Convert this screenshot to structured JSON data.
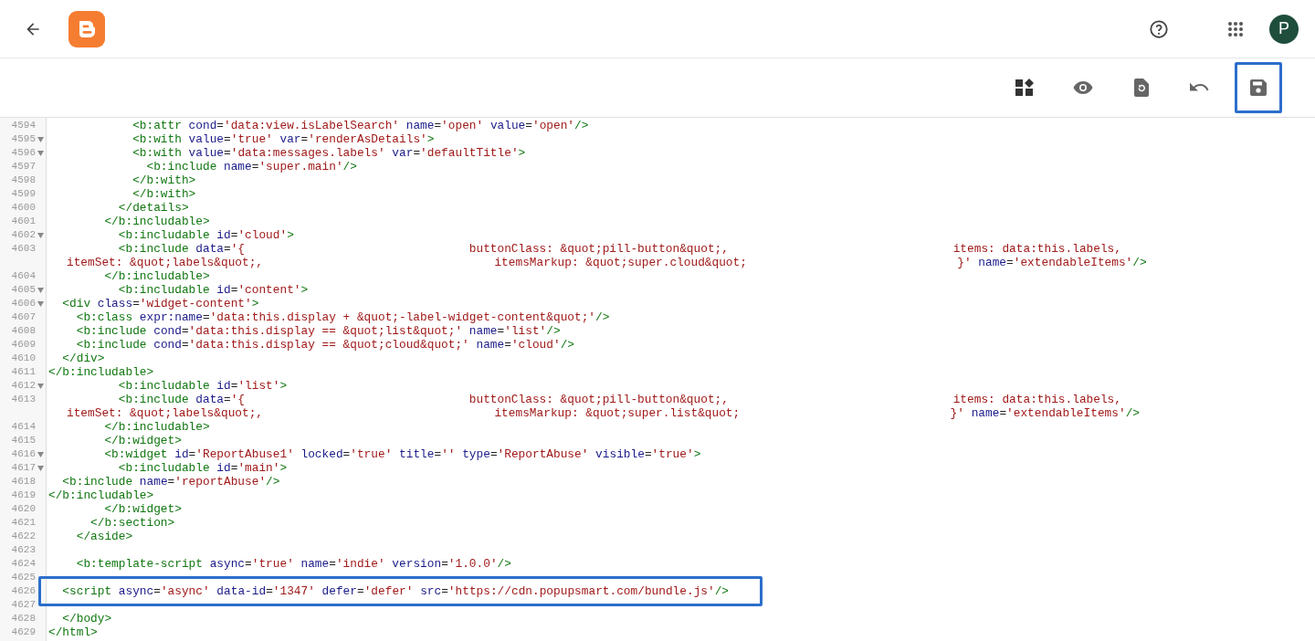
{
  "header": {
    "avatar": {
      "initial": "P"
    }
  },
  "toolbar": [
    {
      "kind": "layout",
      "highlighted": false
    },
    {
      "kind": "preview",
      "highlighted": false
    },
    {
      "kind": "revert",
      "highlighted": false
    },
    {
      "kind": "undo",
      "highlighted": false
    },
    {
      "kind": "save",
      "highlighted": true
    }
  ],
  "editor": {
    "lines": [
      {
        "number": "4594",
        "foldable": false,
        "highlighted": false,
        "text": "            <b:attr cond='data:view.isLabelSearch' name='open' value='open'/>"
      },
      {
        "number": "4595",
        "foldable": true,
        "highlighted": false,
        "text": "            <b:with value='true' var='renderAsDetails'>"
      },
      {
        "number": "4596",
        "foldable": true,
        "highlighted": false,
        "text": "            <b:with value='data:messages.labels' var='defaultTitle'>"
      },
      {
        "number": "4597",
        "foldable": false,
        "highlighted": false,
        "text": "              <b:include name='super.main'/>"
      },
      {
        "number": "4598",
        "foldable": false,
        "highlighted": false,
        "text": "            </b:with>"
      },
      {
        "number": "4599",
        "foldable": false,
        "highlighted": false,
        "text": "            </b:with>"
      },
      {
        "number": "4600",
        "foldable": false,
        "highlighted": false,
        "text": "          </details>"
      },
      {
        "number": "4601",
        "foldable": false,
        "highlighted": false,
        "text": "        </b:includable>"
      },
      {
        "number": "4602",
        "foldable": true,
        "highlighted": false,
        "text": "          <b:includable id='cloud'>"
      },
      {
        "number": "4603",
        "foldable": false,
        "highlighted": false,
        "text": "          <b:include data='{                                buttonClass: &quot;pill-button&quot;,                                items: data:this.labels,",
        "wrap": "itemSet: &quot;labels&quot;,                                 itemsMarkup: &quot;super.cloud&quot;                              }' name='extendableItems'/>"
      },
      {
        "number": "4604",
        "foldable": false,
        "highlighted": false,
        "text": "        </b:includable>"
      },
      {
        "number": "4605",
        "foldable": true,
        "highlighted": false,
        "text": "          <b:includable id='content'>"
      },
      {
        "number": "4606",
        "foldable": true,
        "highlighted": false,
        "text": "  <div class='widget-content'>"
      },
      {
        "number": "4607",
        "foldable": false,
        "highlighted": false,
        "text": "    <b:class expr:name='data:this.display + &quot;-label-widget-content&quot;'/>"
      },
      {
        "number": "4608",
        "foldable": false,
        "highlighted": false,
        "text": "    <b:include cond='data:this.display == &quot;list&quot;' name='list'/>"
      },
      {
        "number": "4609",
        "foldable": false,
        "highlighted": false,
        "text": "    <b:include cond='data:this.display == &quot;cloud&quot;' name='cloud'/>"
      },
      {
        "number": "4610",
        "foldable": false,
        "highlighted": false,
        "text": "  </div>"
      },
      {
        "number": "4611",
        "foldable": false,
        "highlighted": false,
        "text": "</b:includable>"
      },
      {
        "number": "4612",
        "foldable": true,
        "highlighted": false,
        "text": "          <b:includable id='list'>"
      },
      {
        "number": "4613",
        "foldable": false,
        "highlighted": false,
        "text": "          <b:include data='{                                buttonClass: &quot;pill-button&quot;,                                items: data:this.labels,",
        "wrap": "itemSet: &quot;labels&quot;,                                 itemsMarkup: &quot;super.list&quot;                              }' name='extendableItems'/>"
      },
      {
        "number": "4614",
        "foldable": false,
        "highlighted": false,
        "text": "        </b:includable>"
      },
      {
        "number": "4615",
        "foldable": false,
        "highlighted": false,
        "text": "        </b:widget>"
      },
      {
        "number": "4616",
        "foldable": true,
        "highlighted": false,
        "text": "        <b:widget id='ReportAbuse1' locked='true' title='' type='ReportAbuse' visible='true'>"
      },
      {
        "number": "4617",
        "foldable": true,
        "highlighted": false,
        "text": "          <b:includable id='main'>"
      },
      {
        "number": "4618",
        "foldable": false,
        "highlighted": false,
        "text": "  <b:include name='reportAbuse'/>"
      },
      {
        "number": "4619",
        "foldable": false,
        "highlighted": false,
        "text": "</b:includable>"
      },
      {
        "number": "4620",
        "foldable": false,
        "highlighted": false,
        "text": "        </b:widget>"
      },
      {
        "number": "4621",
        "foldable": false,
        "highlighted": false,
        "text": "      </b:section>"
      },
      {
        "number": "4622",
        "foldable": false,
        "highlighted": false,
        "text": "    </aside>"
      },
      {
        "number": "4623",
        "foldable": false,
        "highlighted": false
      },
      {
        "number": "4624",
        "foldable": false,
        "highlighted": false,
        "text": "    <b:template-script async='true' name='indie' version='1.0.0'/>"
      },
      {
        "number": "4625",
        "foldable": false,
        "highlighted": false
      },
      {
        "number": "4626",
        "foldable": false,
        "highlighted": true,
        "text": "  <script async='async' data-id='1347' defer='defer' src='https://cdn.popupsmart.com/bundle.js'/>"
      },
      {
        "number": "4627",
        "foldable": false,
        "highlighted": false
      },
      {
        "number": "4628",
        "foldable": false,
        "highlighted": false,
        "text": "  </body>"
      },
      {
        "number": "4629",
        "foldable": false,
        "highlighted": false,
        "text": "</html>"
      }
    ]
  }
}
